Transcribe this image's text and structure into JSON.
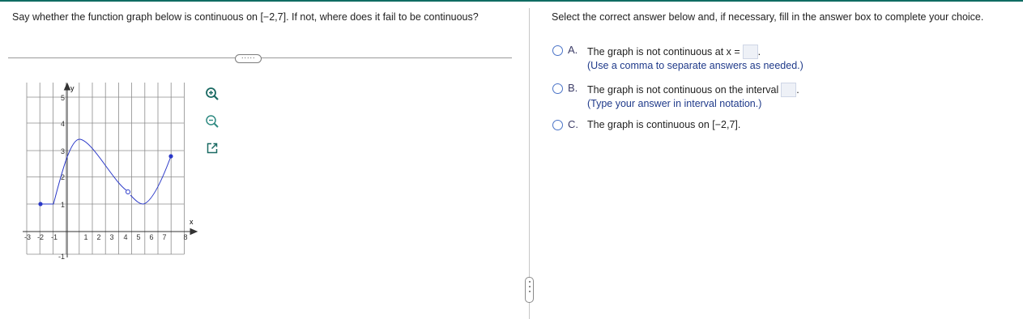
{
  "question": {
    "text": "Say whether the function graph below is continuous on [−2,7]. If not, where does it fail to be continuous?",
    "more_label": "·····"
  },
  "graph": {
    "y_axis_label": "y",
    "x_axis_label": "x",
    "x_ticks": [
      "-3",
      "-2",
      "-1",
      "1",
      "2",
      "3",
      "4",
      "5",
      "6",
      "7",
      "8"
    ],
    "y_ticks": [
      "5",
      "4",
      "3",
      "2",
      "1",
      "-1"
    ],
    "curve_color": "#2a38c8",
    "tools": [
      "zoom-in-icon",
      "zoom-out-icon",
      "popout-icon"
    ]
  },
  "answer": {
    "prompt": "Select the correct answer below and, if necessary, fill in the answer box to complete your choice.",
    "options": [
      {
        "letter": "A.",
        "text": "The graph is not continuous at x =",
        "hint": "(Use a comma to separate answers as needed.)"
      },
      {
        "letter": "B.",
        "text": "The graph is not continuous on the interval",
        "hint": "(Type your answer in interval notation.)"
      },
      {
        "letter": "C.",
        "text": "The graph is continuous on [−2,7].",
        "hint": ""
      }
    ]
  }
}
